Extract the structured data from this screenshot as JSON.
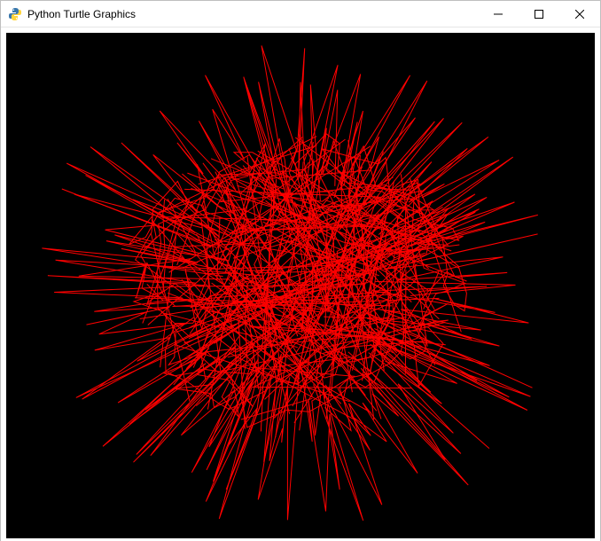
{
  "window": {
    "title": "Python Turtle Graphics",
    "icon_name": "python-turtle-icon"
  },
  "controls": {
    "minimize_name": "minimize-icon",
    "maximize_name": "maximize-icon",
    "close_name": "close-icon"
  },
  "canvas": {
    "bg_color": "#000000",
    "line_color": "#ff0000",
    "line_width": "1",
    "view_w": 664,
    "view_h": 570
  },
  "chart_data": {
    "type": "line",
    "title": "",
    "xlabel": "",
    "ylabel": "",
    "description": "Random-angle turtle walk producing a dense spiky red starburst pattern on black",
    "spikes": 80,
    "inner_radius_min": 80,
    "inner_radius_max": 180,
    "outer_radius_min": 190,
    "outer_radius_max": 300,
    "center": [
      332,
      285
    ],
    "seed": 20231109
  }
}
